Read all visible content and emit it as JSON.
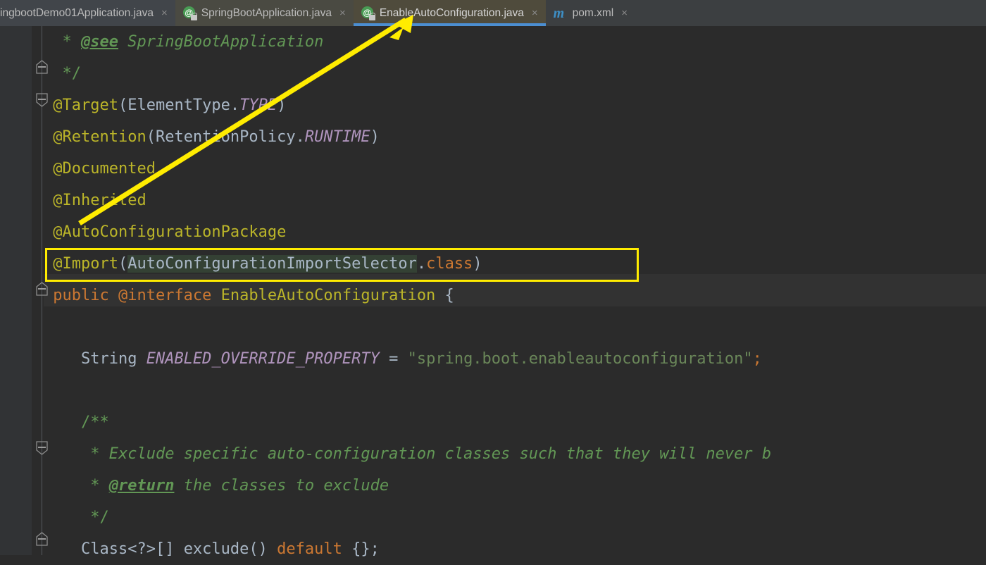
{
  "window": {
    "app": "IntelliJ IDEA Editor",
    "theme_bg": "#2b2b2b"
  },
  "tabbar": {
    "tabs": [
      {
        "label": "ingbootDemo01Application.java",
        "icon": "java-annotation-icon",
        "active": false,
        "close_label": "×"
      },
      {
        "label": "SpringBootApplication.java",
        "icon": "java-annotation-icon",
        "active": false,
        "close_label": "×"
      },
      {
        "label": "EnableAutoConfiguration.java",
        "icon": "java-annotation-icon",
        "active": true,
        "close_label": "×"
      },
      {
        "label": "pom.xml",
        "icon": "maven-icon",
        "active": false,
        "close_label": "×"
      }
    ],
    "maven_icon_glyph": "m",
    "annotation_icon_glyph": "@",
    "active_underline_color": "#4b8ed1",
    "active_tab_bg": "#4f4b3c"
  },
  "editor": {
    "language": "Java",
    "file": "EnableAutoConfiguration.java",
    "lines": [
      {
        "indent": "  ",
        "segments": [
          {
            "text": "* ",
            "cls": "c-cmtp"
          },
          {
            "text": "@see",
            "cls": "c-tag"
          },
          {
            "text": " SpringBootApplication",
            "cls": "c-cmt"
          }
        ]
      },
      {
        "indent": "  ",
        "segments": [
          {
            "text": "*/",
            "cls": "c-cmtp"
          }
        ]
      },
      {
        "indent": " ",
        "segments": [
          {
            "text": "@Target",
            "cls": "c-ann"
          },
          {
            "text": "(",
            "cls": "c-punc"
          },
          {
            "text": "ElementType.",
            "cls": "c-ident"
          },
          {
            "text": "TYPE",
            "cls": "c-static"
          },
          {
            "text": ")",
            "cls": "c-punc"
          }
        ]
      },
      {
        "indent": " ",
        "segments": [
          {
            "text": "@Retention",
            "cls": "c-ann"
          },
          {
            "text": "(",
            "cls": "c-punc"
          },
          {
            "text": "RetentionPolicy.",
            "cls": "c-ident"
          },
          {
            "text": "RUNTIME",
            "cls": "c-static"
          },
          {
            "text": ")",
            "cls": "c-punc"
          }
        ]
      },
      {
        "indent": " ",
        "segments": [
          {
            "text": "@Documented",
            "cls": "c-ann"
          }
        ]
      },
      {
        "indent": " ",
        "segments": [
          {
            "text": "@Inherited",
            "cls": "c-ann"
          }
        ]
      },
      {
        "indent": " ",
        "segments": [
          {
            "text": "@AutoConfigurationPackage",
            "cls": "c-ann"
          }
        ]
      },
      {
        "indent": " ",
        "segments": [
          {
            "text": "@Import",
            "cls": "c-ann"
          },
          {
            "text": "(",
            "cls": "c-punc"
          },
          {
            "text": "AutoConfigurationImportSelector",
            "cls": "c-ident",
            "selected": true
          },
          {
            "text": ".",
            "cls": "c-punc"
          },
          {
            "text": "class",
            "cls": "c-kw"
          },
          {
            "text": ")",
            "cls": "c-punc"
          }
        ]
      },
      {
        "indent": " ",
        "segments": [
          {
            "text": "public ",
            "cls": "c-kw"
          },
          {
            "text": "@interface",
            "cls": "c-kw"
          },
          {
            "text": " EnableAutoConfiguration",
            "cls": "c-ann"
          },
          {
            "text": " {",
            "cls": "c-punc"
          }
        ]
      },
      {
        "indent": "",
        "segments": []
      },
      {
        "indent": "    ",
        "segments": [
          {
            "text": "String ",
            "cls": "c-cls"
          },
          {
            "text": "ENABLED_OVERRIDE_PROPERTY",
            "cls": "c-static"
          },
          {
            "text": " = ",
            "cls": "c-punc"
          },
          {
            "text": "\"spring.boot.enableautoconfiguration\"",
            "cls": "c-str"
          },
          {
            "text": ";",
            "cls": "c-kw"
          }
        ]
      },
      {
        "indent": "",
        "segments": []
      },
      {
        "indent": "    ",
        "segments": [
          {
            "text": "/**",
            "cls": "c-cmtp"
          }
        ]
      },
      {
        "indent": "     ",
        "segments": [
          {
            "text": "* ",
            "cls": "c-cmtp"
          },
          {
            "text": "Exclude specific auto-configuration classes such that they will never b",
            "cls": "c-cmt"
          }
        ]
      },
      {
        "indent": "     ",
        "segments": [
          {
            "text": "* ",
            "cls": "c-cmtp"
          },
          {
            "text": "@return",
            "cls": "c-tag"
          },
          {
            "text": " the classes to exclude",
            "cls": "c-cmt"
          }
        ]
      },
      {
        "indent": "     ",
        "segments": [
          {
            "text": "*/",
            "cls": "c-cmtp"
          }
        ]
      },
      {
        "indent": "    ",
        "segments": [
          {
            "text": "Class<?>[] ",
            "cls": "c-cls"
          },
          {
            "text": "exclude",
            "cls": "c-ident"
          },
          {
            "text": "() ",
            "cls": "c-punc"
          },
          {
            "text": "default",
            "cls": "c-kw"
          },
          {
            "text": " {};",
            "cls": "c-punc"
          }
        ]
      }
    ],
    "selection_text": "AutoConfigurationImportSelector",
    "selection_bg": "#344134",
    "current_line_bg": "#323232",
    "fold_markers": [
      "collapse-fold-1",
      "collapse-fold-2",
      "collapse-fold-3",
      "collapse-fold-4",
      "collapse-fold-5"
    ]
  },
  "annotations": {
    "highlight_rect": {
      "label": "import-line-highlight",
      "color": "#ffec00",
      "target_text": "@Import(AutoConfigurationImportSelector.class)"
    },
    "arrow": {
      "label": "pointer-arrow",
      "color": "#ffec00",
      "from": "@AutoConfigurationPackage line",
      "to": "EnableAutoConfiguration.java tab"
    }
  }
}
